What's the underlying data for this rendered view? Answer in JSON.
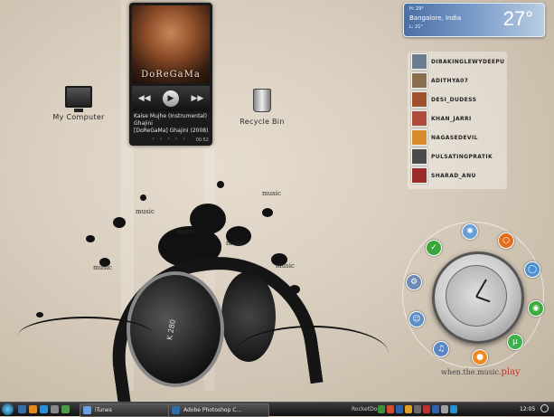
{
  "desktop": {
    "icons": [
      {
        "label": "My Computer",
        "icon": "computer-icon"
      },
      {
        "label": "Recycle Bin",
        "icon": "recycle-bin-icon"
      }
    ]
  },
  "player": {
    "cover_text": "DoReGaMa",
    "track_line1": "Kaise Mujhe (Instrumental)",
    "track_line2": "Ghajini",
    "track_line3": "[DoReGaMa] Ghajini (2008)",
    "time": "00:52"
  },
  "weather": {
    "high": "H: 29°",
    "city": "Bangalore, India",
    "low": "L: 21°",
    "temperature": "27°"
  },
  "contacts": [
    {
      "name": "DIBAKINGLEWYDEEPU",
      "color": "#6b7c8f"
    },
    {
      "name": "ADITHYA07",
      "color": "#8a6d4b"
    },
    {
      "name": "DESI_DUDESS",
      "color": "#a0522d"
    },
    {
      "name": "KHAN_JARRI",
      "color": "#b04a3a"
    },
    {
      "name": "NAGASEDEVIL",
      "color": "#d98a2b"
    },
    {
      "name": "PULSATINGPRATIK",
      "color": "#4b4b4b"
    },
    {
      "name": "SHARAD_ANU",
      "color": "#9c2b2b"
    }
  ],
  "art": {
    "words": [
      "music",
      "music",
      "music",
      "music",
      "music",
      "music"
    ],
    "brand": "K 280"
  },
  "dock": {
    "slogan_prefix": "when.the.music.",
    "slogan_play": "play",
    "icons": [
      {
        "name": "network-icon",
        "color": "#6aa0d8"
      },
      {
        "name": "firefox-icon",
        "color": "#e36d1a"
      },
      {
        "name": "checkmark-icon",
        "color": "#3aa63a"
      },
      {
        "name": "globe-icon",
        "color": "#4a8fd0"
      },
      {
        "name": "chrome-icon",
        "color": "#3caa3c"
      },
      {
        "name": "gear-icon",
        "color": "#6c8bb5"
      },
      {
        "name": "messenger-icon",
        "color": "#5b8fc9"
      },
      {
        "name": "music-note-icon",
        "color": "#5a87c6"
      },
      {
        "name": "firefox-orb-icon",
        "color": "#f08a24"
      },
      {
        "name": "utorrent-icon",
        "color": "#3bb04a"
      }
    ]
  },
  "taskbar": {
    "tasks": [
      {
        "label": "iTunes",
        "icon_color": "#6aa0e0"
      },
      {
        "label": "Adobe Photoshop C...",
        "icon_color": "#2f6ca8"
      }
    ],
    "now_playing": "RocketDock",
    "tray_colors": [
      "#3a8f3a",
      "#d94a2a",
      "#2a62b0",
      "#e0a020",
      "#6a6a6a",
      "#c03030",
      "#3060b0",
      "#a0a0a0",
      "#2a8fd0"
    ],
    "time": "12:05"
  }
}
